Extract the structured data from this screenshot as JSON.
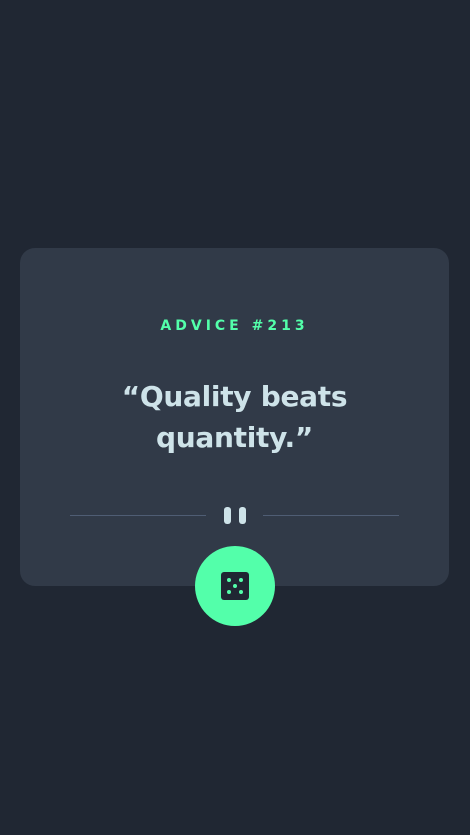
{
  "advice": {
    "label": "ADVICE #213",
    "quote": "“Quality beats quantity.”"
  },
  "dice_button": {
    "icon": "dice-icon",
    "color": "#53ffaa"
  },
  "divider": {
    "icon": "pause-icon"
  },
  "colors": {
    "background": "#202733",
    "card": "#313a48",
    "accent": "#53ffaa",
    "text": "#cee3e9",
    "divider": "#4f5d74"
  }
}
